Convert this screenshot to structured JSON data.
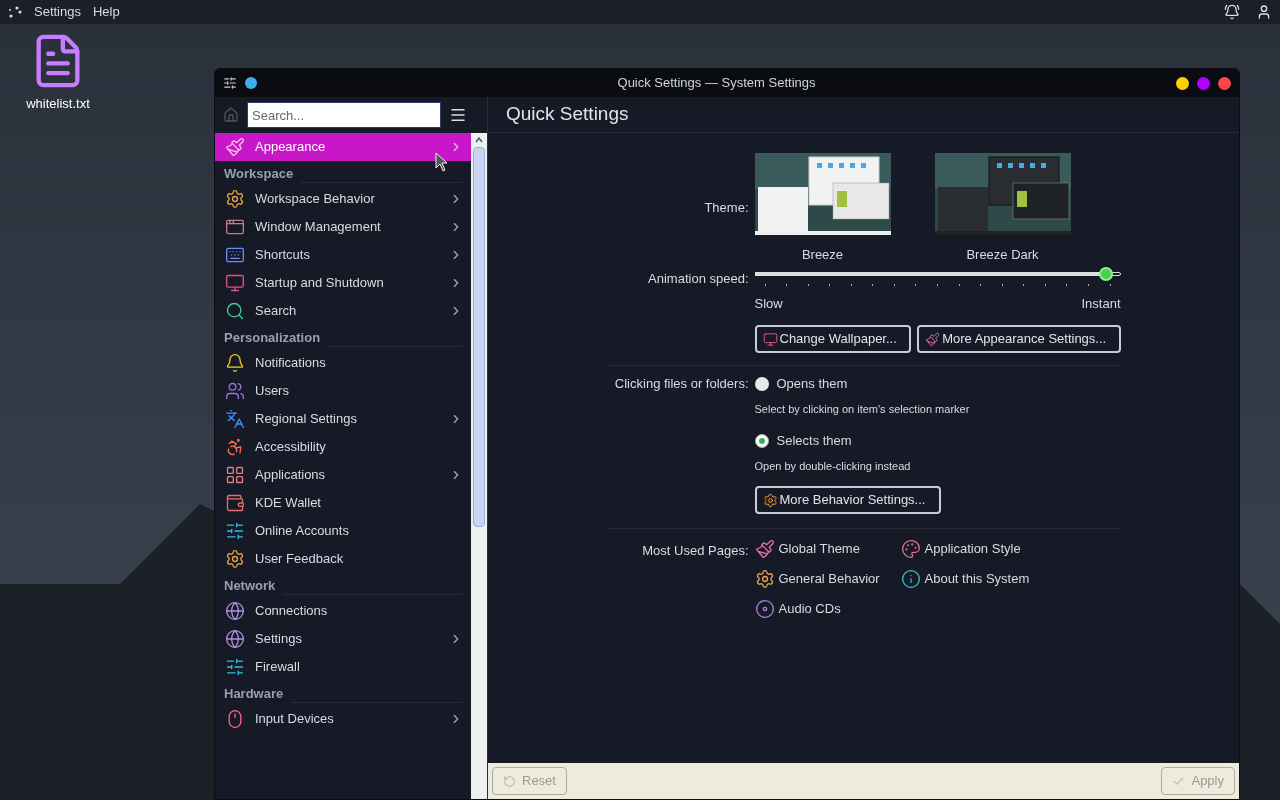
{
  "top_bar": {
    "menus": [
      "Settings",
      "Help"
    ]
  },
  "desktop_icons": [
    {
      "label": "whitelist.txt"
    }
  ],
  "window": {
    "title": "Quick Settings — System Settings",
    "controls": [
      {
        "color": "#ffd000"
      },
      {
        "color": "#b000ff"
      },
      {
        "color": "#ff4545"
      }
    ]
  },
  "sidebar": {
    "search": {
      "placeholder": "Search..."
    },
    "items": [
      {
        "kind": "item",
        "label": "Appearance",
        "arrow": true,
        "selected": true
      },
      {
        "kind": "header",
        "label": "Workspace"
      },
      {
        "kind": "item",
        "label": "Workspace Behavior",
        "arrow": true,
        "selected": false
      },
      {
        "kind": "item",
        "label": "Window Management",
        "arrow": true,
        "selected": false
      },
      {
        "kind": "item",
        "label": "Shortcuts",
        "arrow": true,
        "selected": false
      },
      {
        "kind": "item",
        "label": "Startup and Shutdown",
        "arrow": true,
        "selected": false
      },
      {
        "kind": "item",
        "label": "Search",
        "arrow": true,
        "selected": false
      },
      {
        "kind": "header",
        "label": "Personalization"
      },
      {
        "kind": "item",
        "label": "Notifications",
        "arrow": false,
        "selected": false
      },
      {
        "kind": "item",
        "label": "Users",
        "arrow": false,
        "selected": false
      },
      {
        "kind": "item",
        "label": "Regional Settings",
        "arrow": true,
        "selected": false
      },
      {
        "kind": "item",
        "label": "Accessibility",
        "arrow": false,
        "selected": false
      },
      {
        "kind": "item",
        "label": "Applications",
        "arrow": true,
        "selected": false
      },
      {
        "kind": "item",
        "label": "KDE Wallet",
        "arrow": false,
        "selected": false
      },
      {
        "kind": "item",
        "label": "Online Accounts",
        "arrow": false,
        "selected": false
      },
      {
        "kind": "item",
        "label": "User Feedback",
        "arrow": false,
        "selected": false
      },
      {
        "kind": "header",
        "label": "Network"
      },
      {
        "kind": "item",
        "label": "Connections",
        "arrow": false,
        "selected": false
      },
      {
        "kind": "item",
        "label": "Settings",
        "arrow": true,
        "selected": false
      },
      {
        "kind": "item",
        "label": "Firewall",
        "arrow": false,
        "selected": false
      },
      {
        "kind": "header",
        "label": "Hardware"
      },
      {
        "kind": "item",
        "label": "Input Devices",
        "arrow": true,
        "selected": false
      }
    ]
  },
  "page": {
    "title": "Quick Settings",
    "theme": {
      "label": "Theme:",
      "options": [
        {
          "name": "Breeze",
          "kind": "light"
        },
        {
          "name": "Breeze Dark",
          "kind": "dark"
        }
      ]
    },
    "animation": {
      "label": "Animation speed:",
      "level": 1.0,
      "min_label": "Slow",
      "max_label": "Instant"
    },
    "appearance_buttons": [
      "Change Wallpaper...",
      "More Appearance Settings..."
    ],
    "clicking": {
      "label": "Clicking files or folders:",
      "options": [
        {
          "label": "Opens them",
          "hint": "Select by clicking on item's selection marker",
          "selected": false
        },
        {
          "label": "Selects them",
          "hint": "Open by double-clicking instead",
          "selected": true
        }
      ]
    },
    "behavior_button": "More Behavior Settings...",
    "most_used": {
      "label": "Most Used Pages:",
      "links": [
        "Global Theme",
        "Application Style",
        "General Behavior",
        "About this System",
        "Audio CDs"
      ]
    }
  },
  "footer": {
    "reset": "Reset",
    "apply": "Apply"
  }
}
